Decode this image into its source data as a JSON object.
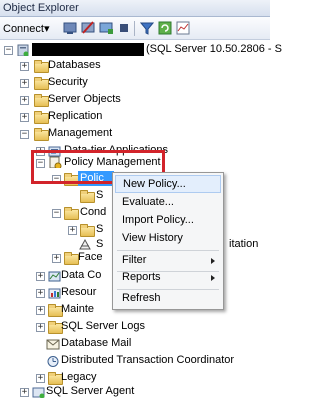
{
  "window": {
    "title": "Object Explorer"
  },
  "toolbar": {
    "connect_label": "Connect▾"
  },
  "tree": {
    "server_suffix": "(SQL Server 10.50.2806 - S",
    "databases": "Databases",
    "security": "Security",
    "server_objects": "Server Objects",
    "replication": "Replication",
    "management": "Management",
    "data_tier": "Data-tier Applications",
    "policy_mgmt": "Policy Management",
    "policies_partial": "Polic",
    "s1": "S",
    "cond_partial": "Cond",
    "s2": "S",
    "s3": "S",
    "itation_partial": "itation",
    "face_partial": "Face",
    "data_co_partial": "Data Co",
    "resour_partial": "Resour",
    "mainte_partial": "Mainte",
    "sql_logs": "SQL Server Logs",
    "db_mail": "Database Mail",
    "dtc": "Distributed Transaction Coordinator",
    "legacy": "Legacy",
    "agent": "SQL Server Agent"
  },
  "context_menu": {
    "new_policy": "New Policy...",
    "evaluate": "Evaluate...",
    "import_policy": "Import Policy...",
    "view_history": "View History",
    "filter": "Filter",
    "reports": "Reports",
    "refresh": "Refresh"
  }
}
